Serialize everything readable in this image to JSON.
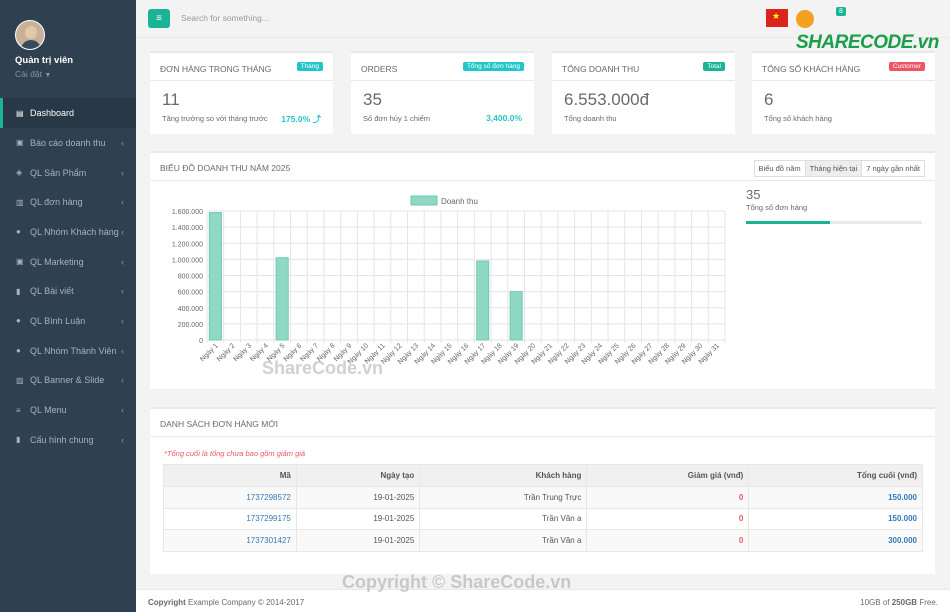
{
  "sidebar": {
    "user_name": "Quản trị viên",
    "user_sub": "Cài đặt",
    "items": [
      {
        "label": "Dashboard",
        "icon": "database-icon"
      },
      {
        "label": "Báo cáo doanh thu",
        "icon": "money-icon"
      },
      {
        "label": "QL Sản Phẩm",
        "icon": "cube-icon"
      },
      {
        "label": "QL đơn hàng",
        "icon": "bag-icon"
      },
      {
        "label": "QL Nhóm Khách hàng",
        "icon": "user-icon"
      },
      {
        "label": "QL Marketing",
        "icon": "money-icon"
      },
      {
        "label": "QL Bài viết",
        "icon": "file-icon"
      },
      {
        "label": "QL Bình Luận",
        "icon": "comment-icon"
      },
      {
        "label": "QL Nhóm Thành Viên",
        "icon": "user-icon"
      },
      {
        "label": "QL Banner & Slide",
        "icon": "image-icon"
      },
      {
        "label": "QL Menu",
        "icon": "bars-icon"
      },
      {
        "label": "Cấu hình chung",
        "icon": "file-icon"
      }
    ]
  },
  "topbar": {
    "search_placeholder": "Search for something...",
    "badge_count": "8",
    "logo_text": "SHARECODE.vn"
  },
  "stats": [
    {
      "title": "ĐƠN HÀNG TRONG THÁNG",
      "badge": "Tháng",
      "badge_color": "#23c6c8",
      "value": "11",
      "sub": "Tăng trưởng so với tháng trước",
      "pct": "175.0% ⤴",
      "pct_color": "#23c6c8"
    },
    {
      "title": "ORDERS",
      "badge": "Tổng số đơn hàng",
      "badge_color": "#23c6c8",
      "value": "35",
      "sub": "Số đơn hủy 1 chiếm",
      "pct": "3,400.0%",
      "pct_color": "#23c6c8"
    },
    {
      "title": "TỔNG DOANH THU",
      "badge": "Total",
      "badge_color": "#1ab394",
      "value": "6.553.000đ",
      "sub": "Tổng doanh thu",
      "pct": "",
      "pct_color": "#23c6c8"
    },
    {
      "title": "TỔNG SỐ KHÁCH HÀNG",
      "badge": "Customer",
      "badge_color": "#ed5565",
      "value": "6",
      "sub": "Tổng số khách hàng",
      "pct": "",
      "pct_color": "#23c6c8"
    }
  ],
  "chart_panel": {
    "title": "BIỂU ĐỒ DOANH THU NĂM 2025",
    "buttons": [
      "Biểu đồ năm",
      "Tháng hiện tại",
      "7 ngày gần nhất"
    ],
    "side_value": "35",
    "side_label": "Tổng số đơn hàng",
    "progress": 0.48
  },
  "chart_data": {
    "type": "bar",
    "legend": "Doanh thu",
    "color": "#8fd9c4",
    "ylim": [
      0,
      1600000
    ],
    "yticks": [
      "0",
      "200.000",
      "400.000",
      "600.000",
      "800.000",
      "1.000.000",
      "1.200.000",
      "1.400.000",
      "1.600.000"
    ],
    "categories": [
      "Ngày 1",
      "Ngày 2",
      "Ngày 3",
      "Ngày 4",
      "Ngày 5",
      "Ngày 6",
      "Ngày 7",
      "Ngày 8",
      "Ngày 9",
      "Ngày 10",
      "Ngày 11",
      "Ngày 12",
      "Ngày 13",
      "Ngày 14",
      "Ngày 15",
      "Ngày 16",
      "Ngày 17",
      "Ngày 18",
      "Ngày 19",
      "Ngày 20",
      "Ngày 21",
      "Ngày 22",
      "Ngày 23",
      "Ngày 24",
      "Ngày 25",
      "Ngày 26",
      "Ngày 27",
      "Ngày 28",
      "Ngày 29",
      "Ngày 30",
      "Ngày 31"
    ],
    "values": [
      1580000,
      0,
      0,
      0,
      1020000,
      0,
      0,
      0,
      0,
      0,
      0,
      0,
      0,
      0,
      0,
      0,
      980000,
      0,
      600000,
      0,
      0,
      0,
      0,
      0,
      0,
      0,
      0,
      0,
      0,
      0,
      0
    ]
  },
  "orders_panel": {
    "title": "DANH SÁCH ĐƠN HÀNG MỚI",
    "note": "*Tổng cuối là tổng chưa bao gồm giảm giá",
    "headers": [
      "Mã",
      "Ngày tạo",
      "Khách hàng",
      "Giảm giá (vnđ)",
      "Tổng cuối (vnđ)"
    ],
    "rows": [
      [
        "1737298572",
        "19-01-2025",
        "Trần Trung Trực",
        "0",
        "150.000"
      ],
      [
        "1737299175",
        "19-01-2025",
        "Trần Văn a",
        "0",
        "150.000"
      ],
      [
        "1737301427",
        "19-01-2025",
        "Trần Văn a",
        "0",
        "300.000"
      ]
    ]
  },
  "footer": {
    "copyright_bold": "Copyright",
    "copyright": "Example Company © 2014-2017",
    "storage": "10GB of",
    "storage_bold": "250GB",
    "storage_end": "Free."
  },
  "watermark": "ShareCode.vn",
  "watermark2": "Copyright © ShareCode.vn"
}
